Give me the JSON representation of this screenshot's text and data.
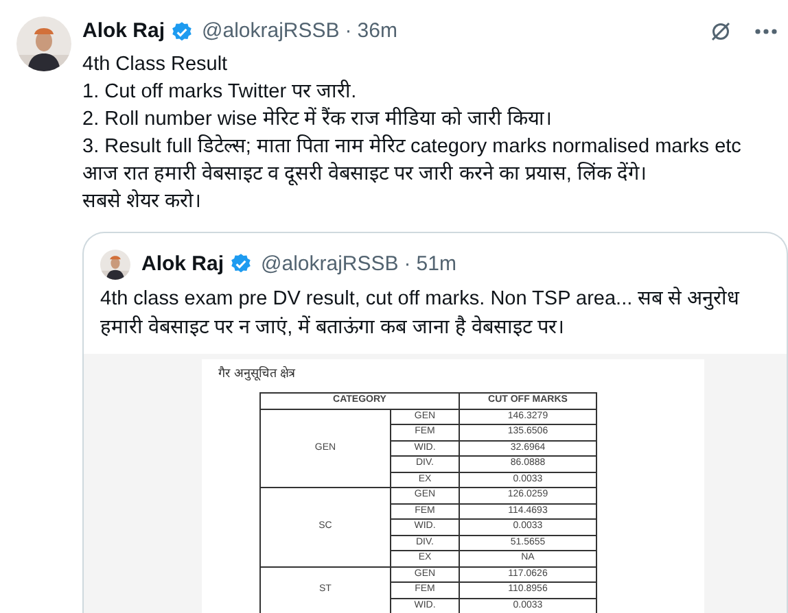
{
  "post": {
    "author": "Alok Raj",
    "verified": true,
    "handle": "@alokrajRSSB",
    "separator": "·",
    "time": "36m",
    "lines": [
      "4th Class Result",
      "1. Cut off marks Twitter पर जारी.",
      "2. Roll number wise मेरिट में रैंक राज मीडिया को जारी किया।",
      "3. Result full डिटेल्स; माता पिता नाम मेरिट category marks normalised marks etc",
      "आज रात हमारी वेबसाइट व दूसरी वेबसाइट पर जारी करने का प्रयास, लिंक देंगे।",
      "सबसे शेयर करो।"
    ]
  },
  "quote": {
    "author": "Alok Raj",
    "verified": true,
    "handle": "@alokrajRSSB",
    "separator": "·",
    "time": "51m",
    "text": "4th class exam pre DV result, cut off marks. Non TSP area... सब से अनुरोध हमारी वेबसाइट पर न जाएं, में बताऊंगा कब जाना है वेबसाइट पर।",
    "document": {
      "heading": "गैर अनुसूचित क्षेत्र",
      "columns": [
        "CATEGORY",
        "CUT OFF MARKS"
      ],
      "groups": [
        {
          "name": "GEN",
          "rows": [
            {
              "sub": "GEN",
              "marks": "146.3279"
            },
            {
              "sub": "FEM",
              "marks": "135.6506"
            },
            {
              "sub": "WID.",
              "marks": "32.6964"
            },
            {
              "sub": "DIV.",
              "marks": "86.0888"
            },
            {
              "sub": "EX",
              "marks": "0.0033"
            }
          ]
        },
        {
          "name": "SC",
          "rows": [
            {
              "sub": "GEN",
              "marks": "126.0259"
            },
            {
              "sub": "FEM",
              "marks": "114.4693"
            },
            {
              "sub": "WID.",
              "marks": "0.0033"
            },
            {
              "sub": "DIV.",
              "marks": "51.5655"
            },
            {
              "sub": "EX",
              "marks": "NA"
            }
          ]
        },
        {
          "name": "ST",
          "rows": [
            {
              "sub": "GEN",
              "marks": "117.0626"
            },
            {
              "sub": "FEM",
              "marks": "110.8956"
            },
            {
              "sub": "WID.",
              "marks": "0.0033"
            }
          ]
        }
      ]
    }
  }
}
